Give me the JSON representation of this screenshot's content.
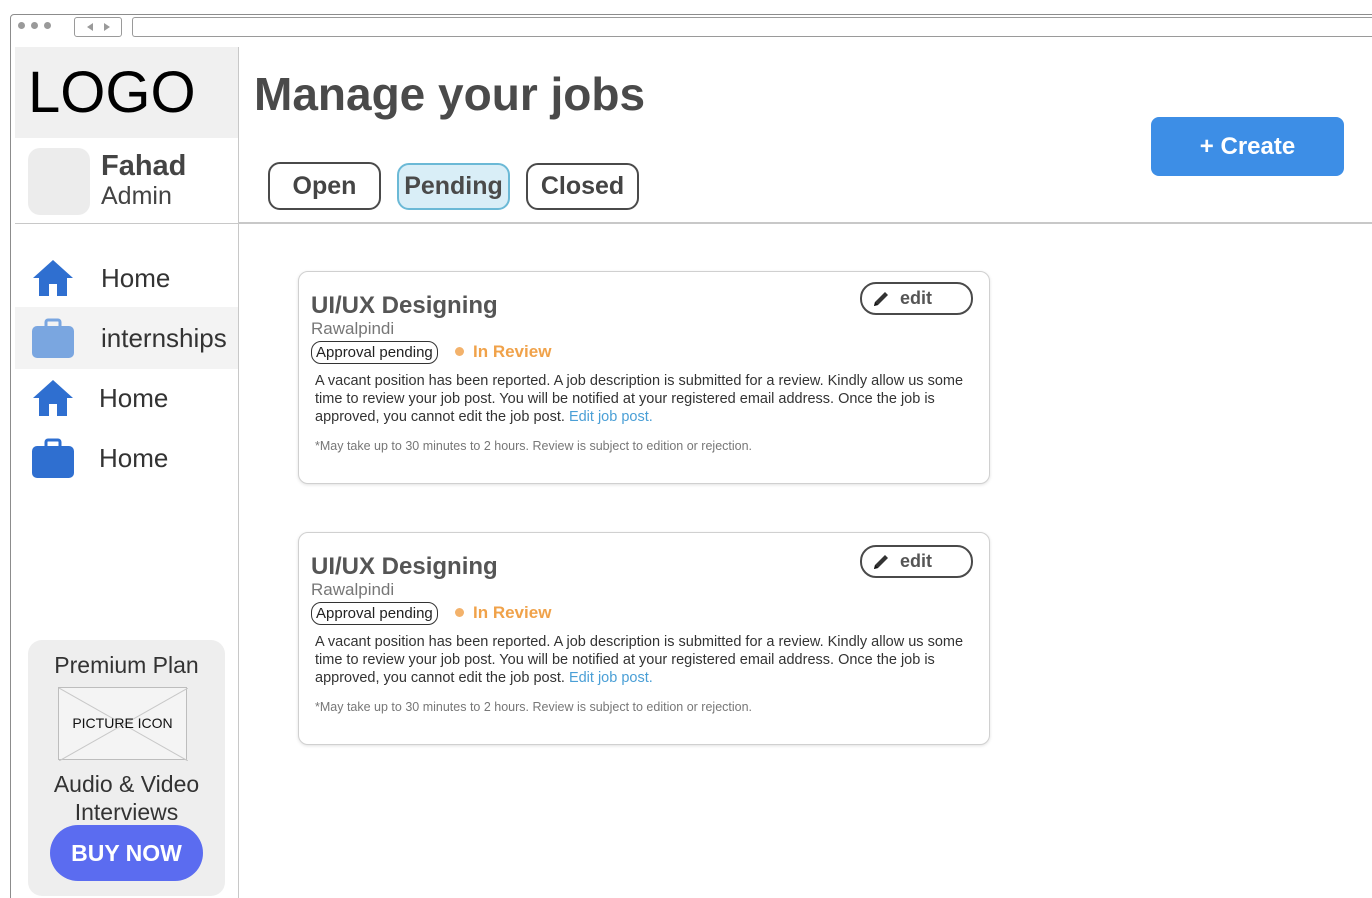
{
  "sidebar": {
    "logo": "LOGO",
    "user": {
      "name": "Fahad",
      "role": "Admin"
    },
    "nav": [
      {
        "label": "Home",
        "icon": "home-icon",
        "active": false
      },
      {
        "label": "internships",
        "icon": "briefcase-icon",
        "active": true
      },
      {
        "label": "Home",
        "icon": "home-icon",
        "active": false
      },
      {
        "label": "Home",
        "icon": "briefcase-icon",
        "active": false
      }
    ],
    "premium": {
      "title": "Premium Plan",
      "picture_label": "PICTURE ICON",
      "desc_line1": "Audio & Video",
      "desc_line2": "Interviews",
      "cta": "BUY NOW"
    }
  },
  "main": {
    "title": "Manage your jobs",
    "create_label": "+ Create",
    "tabs": [
      {
        "label": "Open",
        "active": false
      },
      {
        "label": "Pending",
        "active": true
      },
      {
        "label": "Closed",
        "active": false
      }
    ],
    "jobs": [
      {
        "title": "UI/UX Designing",
        "location": "Rawalpindi",
        "badge": "Approval pending",
        "status": "In Review",
        "description": "A vacant position has been reported. A job description is submitted for a review. Kindly allow us some time to review your job post. You will be notified at your registered email address. Once the job is approved, you cannot edit the job post.",
        "edit_link": "Edit job post.",
        "note": "*May take up to 30 minutes to 2 hours. Review is subject to edition or rejection.",
        "edit_label": "edit"
      },
      {
        "title": "UI/UX Designing",
        "location": "Rawalpindi",
        "badge": "Approval pending",
        "status": "In Review",
        "description": "A vacant position has been reported. A job description is submitted for a review. Kindly allow us some time to review your job post. You will be notified at your registered email address. Once the job is approved, you cannot edit the job post.",
        "edit_link": "Edit job post.",
        "note": "*May take up to 30 minutes to 2 hours. Review is subject to edition or rejection.",
        "edit_label": "edit"
      }
    ]
  },
  "colors": {
    "primary_blue": "#3d8ee6",
    "buy_now": "#5b6cf0",
    "active_tab_bg": "#d9eef7",
    "review_orange": "#f0a24a",
    "link_blue": "#4a9fd6"
  }
}
